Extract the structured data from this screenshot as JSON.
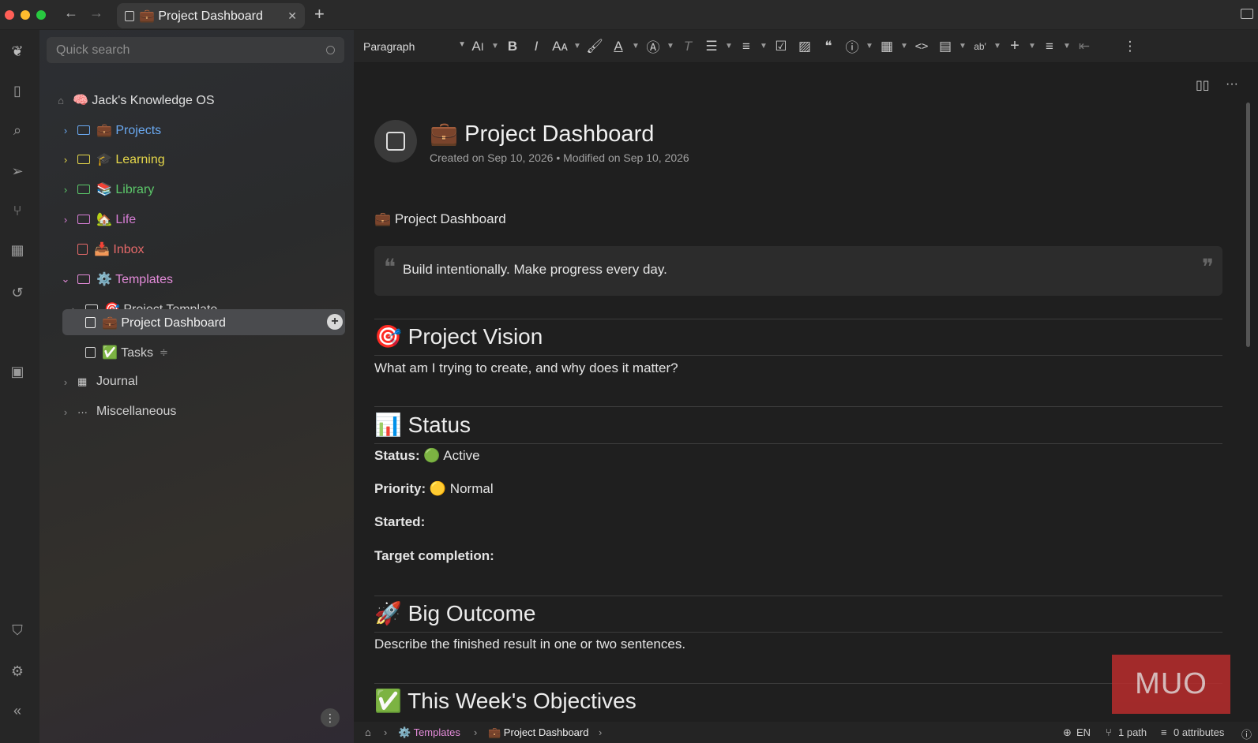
{
  "tab": {
    "title": "💼 Project Dashboard"
  },
  "sidebar": {
    "search_placeholder": "Quick search",
    "root": "🧠 Jack's Knowledge OS",
    "items": [
      {
        "label": "💼 Projects",
        "color": "#6aa8f0"
      },
      {
        "label": "🎓 Learning",
        "color": "#e6d84a"
      },
      {
        "label": "📚 Library",
        "color": "#5cc96a"
      },
      {
        "label": "🏡 Life",
        "color": "#d77ed6"
      },
      {
        "label": "📥 Inbox",
        "color": "#e66a6a"
      },
      {
        "label": "⚙️ Templates",
        "color": "#e38bd9"
      },
      {
        "label": "🎯 Project Template",
        "color": "#d0d0d0"
      },
      {
        "label": "💼 Project Dashboard",
        "color": "#f0f0f0"
      },
      {
        "label": "✅ Tasks",
        "color": "#d0d0d0"
      },
      {
        "label": "Journal",
        "color": "#d0d0d0"
      },
      {
        "label": "Miscellaneous",
        "color": "#d0d0d0"
      }
    ]
  },
  "toolbar": {
    "paragraph": "Paragraph"
  },
  "note": {
    "title": "💼 Project Dashboard",
    "meta": "Created on Sep 10, 2026 • Modified on Sep 10, 2026",
    "intro": "💼 Project Dashboard",
    "quote": "Build intentionally. Make progress every day.",
    "vision_heading": "🎯 Project Vision",
    "vision_text": "What am I trying to create, and why does it matter?",
    "status_heading": "📊 Status",
    "status_label": "Status:",
    "status_value": "🟢 Active",
    "priority_label": "Priority:",
    "priority_value": "🟡 Normal",
    "started_label": "Started:",
    "target_label": "Target completion:",
    "outcome_heading": "🚀 Big Outcome",
    "outcome_text": "Describe the finished result in one or two sentences.",
    "objectives_heading": "✅ This Week's Objectives"
  },
  "statusbar": {
    "crumb_templates": "⚙️ Templates",
    "crumb_note": "💼 Project Dashboard",
    "lang": "EN",
    "paths": "1 path",
    "attributes": "0 attributes"
  },
  "watermark": "MUO"
}
